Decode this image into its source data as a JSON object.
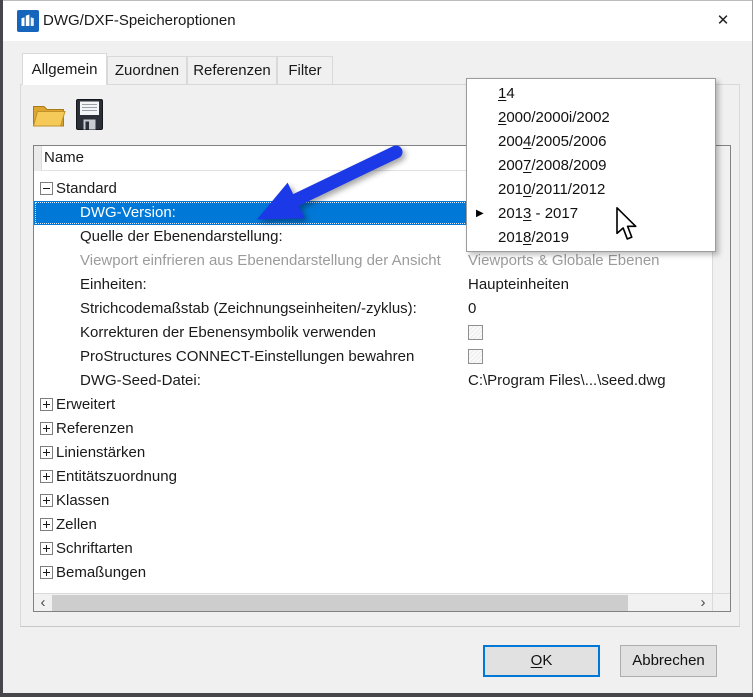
{
  "window": {
    "title": "DWG/DXF-Speicheroptionen",
    "close_glyph": "✕",
    "app_icon": "bentley-microstation-icon"
  },
  "tabs": [
    {
      "label": "Allgemein",
      "active": true
    },
    {
      "label": "Zuordnen",
      "active": false
    },
    {
      "label": "Referenzen",
      "active": false
    },
    {
      "label": "Filter",
      "active": false
    }
  ],
  "toolbar": {
    "open_icon": "open-folder-icon",
    "save_icon": "save-floppy-icon"
  },
  "list": {
    "header": "Name",
    "rows": [
      {
        "type": "group",
        "label": "Standard",
        "expanded": true
      },
      {
        "type": "item",
        "label": "DWG-Version:",
        "value": "",
        "selected": true
      },
      {
        "type": "item",
        "label": "Quelle der Ebenendarstellung:",
        "value": ""
      },
      {
        "type": "item",
        "label": "Viewport einfrieren aus Ebenendarstellung der Ansicht",
        "value": "Viewports & Globale Ebenen",
        "disabled": true
      },
      {
        "type": "item",
        "label": "Einheiten:",
        "value": "Haupteinheiten"
      },
      {
        "type": "item",
        "label": "Strichcodemaßstab (Zeichnungseinheiten/-zyklus):",
        "value": "0"
      },
      {
        "type": "item",
        "label": "Korrekturen der Ebenensymbolik verwenden",
        "checkbox": true,
        "checked": false
      },
      {
        "type": "item",
        "label": "ProStructures CONNECT-Einstellungen bewahren",
        "checkbox": true,
        "checked": false
      },
      {
        "type": "item",
        "label": "DWG-Seed-Datei:",
        "value": "C:\\Program Files\\...\\seed.dwg"
      },
      {
        "type": "group",
        "label": "Erweitert",
        "expanded": false
      },
      {
        "type": "group",
        "label": "Referenzen",
        "expanded": false
      },
      {
        "type": "group",
        "label": "Linienstärken",
        "expanded": false
      },
      {
        "type": "group",
        "label": "Entitätszuordnung",
        "expanded": false
      },
      {
        "type": "group",
        "label": "Klassen",
        "expanded": false
      },
      {
        "type": "group",
        "label": "Zellen",
        "expanded": false
      },
      {
        "type": "group",
        "label": "Schriftarten",
        "expanded": false
      },
      {
        "type": "group",
        "label": "Bemaßungen",
        "expanded": false
      }
    ]
  },
  "version_menu": {
    "marker_glyph": "▶",
    "items": [
      {
        "label": "14",
        "accel_index": 0,
        "checked": false
      },
      {
        "label": "2000/2000i/2002",
        "accel_index": 0,
        "checked": false
      },
      {
        "label": "2004/2005/2006",
        "accel_index": 3,
        "checked": false
      },
      {
        "label": "2007/2008/2009",
        "accel_index": 3,
        "checked": false
      },
      {
        "label": "2010/2011/2012",
        "accel_index": 3,
        "checked": false
      },
      {
        "label": "2013 - 2017",
        "accel_index": 3,
        "checked": true
      },
      {
        "label": "2018/2019",
        "accel_index": 3,
        "checked": false
      }
    ]
  },
  "scrollbar": {
    "left_glyph": "‹",
    "right_glyph": "›"
  },
  "buttons": {
    "ok": "OK",
    "ok_accel_index": 0,
    "cancel": "Abbrechen"
  },
  "colors": {
    "selection": "#0078d7",
    "annotation_arrow": "#1c39e8",
    "accent": "#0078d7",
    "title_bar": "#ffffff",
    "dialog_bg": "#f0f0f0"
  }
}
